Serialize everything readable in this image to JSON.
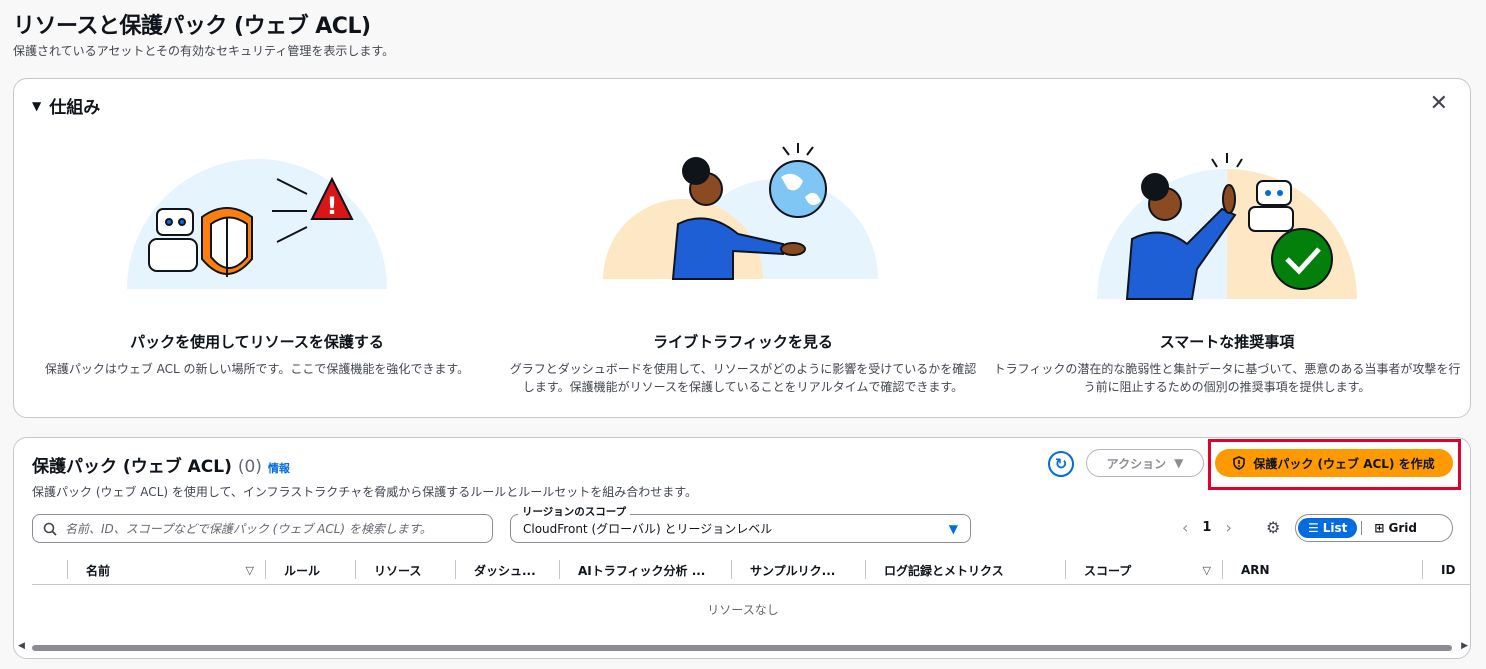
{
  "header": {
    "title": "リソースと保護パック (ウェブ ACL)",
    "description": "保護されているアセットとその有効なセキュリティ管理を表示します。"
  },
  "how_it_works": {
    "toggle_icon": "caret-down-icon",
    "title": "仕組み",
    "close_icon": "close-icon",
    "features": [
      {
        "title": "パックを使用してリソースを保護する",
        "description": "保護パックはウェブ ACL の新しい場所です。ここで保護機能を強化できます。"
      },
      {
        "title": "ライブトラフィックを見る",
        "description": "グラフとダッシュボードを使用して、リソースがどのように影響を受けているかを確認します。保護機能がリソースを保護していることをリアルタイムで確認できます。"
      },
      {
        "title": "スマートな推奨事項",
        "description": "トラフィックの潜在的な脆弱性と集計データに基づいて、悪意のある当事者が攻撃を行う前に阻止するための個別の推奨事項を提供します。"
      }
    ]
  },
  "protection_packs": {
    "title": "保護パック (ウェブ ACL)",
    "count": "(0)",
    "info_link": "情報",
    "description": "保護パック (ウェブ ACL) を使用して、インフラストラクチャを脅威から保護するルールとルールセットを組み合わせます。",
    "refresh_icon": "refresh-icon",
    "actions_label": "アクション",
    "create_label": "保護パック (ウェブ ACL) を作成",
    "search_placeholder": "名前、ID、スコープなどで保護パック (ウェブ ACL) を検索します。",
    "scope_label": "リージョンのスコープ",
    "scope_value": "CloudFront (グローバル) とリージョンレベル",
    "page_number": "1",
    "view_list_label": "List",
    "view_grid_label": "Grid",
    "columns": [
      "名前",
      "ルール",
      "リソース",
      "ダッシュ...",
      "AIトラフィック分析 ...",
      "サンプルリク...",
      "ログ記録とメトリクス",
      "スコープ",
      "ARN",
      "ID"
    ],
    "empty_text": "リソースなし"
  },
  "colors": {
    "primary_button": "#ff9900",
    "link": "#006ce0",
    "highlight": "#e0002b"
  }
}
